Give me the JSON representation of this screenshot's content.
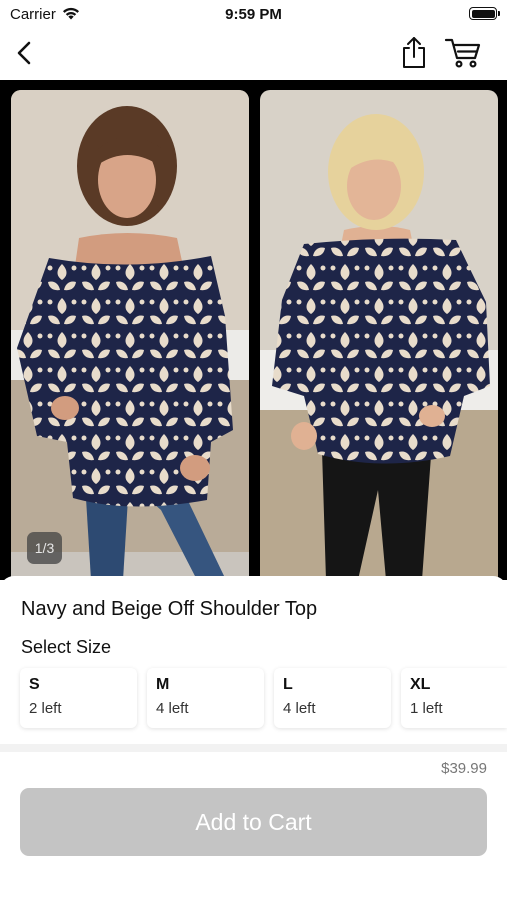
{
  "status_bar": {
    "carrier": "Carrier",
    "time": "9:59 PM",
    "wifi_icon": "wifi-icon",
    "battery_icon": "battery-icon"
  },
  "nav": {
    "back_icon": "chevron-left-icon",
    "share_icon": "share-icon",
    "cart_icon": "cart-icon"
  },
  "gallery": {
    "page_indicator": "1/3",
    "current_page": 1,
    "total_pages": 3
  },
  "product": {
    "title": "Navy and Beige Off Shoulder Top",
    "size_heading": "Select Size",
    "sizes": [
      {
        "code": "S",
        "stock": "2 left"
      },
      {
        "code": "M",
        "stock": "4 left"
      },
      {
        "code": "L",
        "stock": "4 left"
      },
      {
        "code": "XL",
        "stock": "1 left"
      }
    ],
    "price": "$39.99",
    "add_to_cart_label": "Add to Cart"
  },
  "colors": {
    "button_disabled": "#c4c4c4",
    "gallery_background": "#000000",
    "top_navy": "#1e2548",
    "top_beige": "#e8dccb"
  }
}
